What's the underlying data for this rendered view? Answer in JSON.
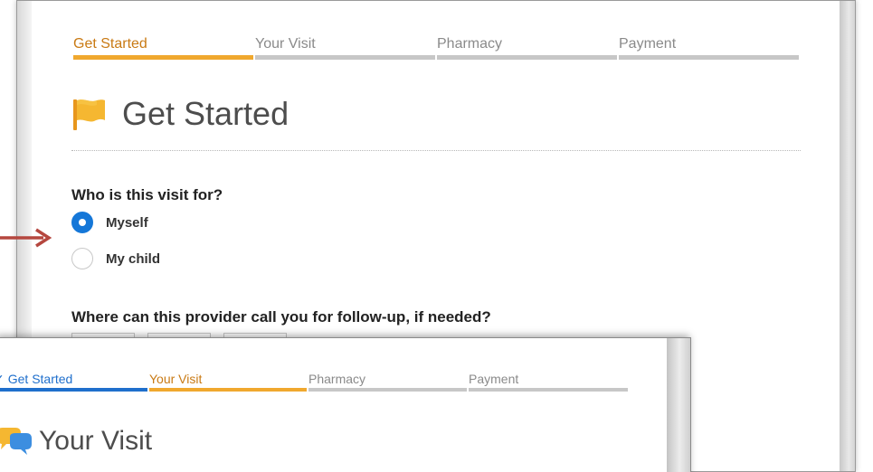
{
  "main": {
    "steps": [
      {
        "label": "Get Started",
        "state": "active"
      },
      {
        "label": "Your Visit",
        "state": "inactive"
      },
      {
        "label": "Pharmacy",
        "state": "inactive"
      },
      {
        "label": "Payment",
        "state": "inactive"
      }
    ],
    "title": "Get Started",
    "title_icon": "flag-icon",
    "question1": "Who is this visit for?",
    "options": [
      {
        "label": "Myself",
        "checked": true
      },
      {
        "label": "My child",
        "checked": false
      }
    ],
    "question2": "Where can this provider call you for follow-up, if needed?"
  },
  "overlay": {
    "steps": [
      {
        "label": "Get Started",
        "state": "done",
        "check": "✓"
      },
      {
        "label": "Your Visit",
        "state": "active"
      },
      {
        "label": "Pharmacy",
        "state": "inactive"
      },
      {
        "label": "Payment",
        "state": "inactive"
      }
    ],
    "title": "Your Visit",
    "title_icon": "chat-bubbles-icon"
  },
  "colors": {
    "accent_orange": "#f0a82e",
    "accent_blue": "#1f6fcc",
    "radio_blue": "#1577d8",
    "arrow_red": "#b5473f"
  }
}
